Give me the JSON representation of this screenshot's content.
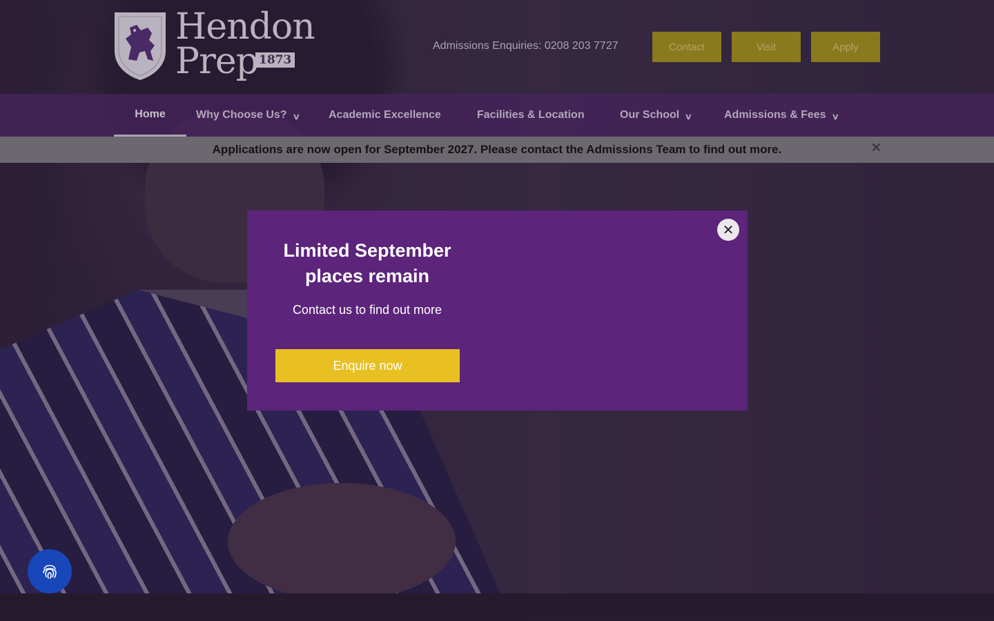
{
  "header": {
    "logo_line1": "Hendon",
    "logo_line2": "Prep",
    "logo_year": "1873",
    "phone_text": "Admissions Enquiries: 0208 203 7727",
    "buttons": [
      "Contact",
      "Visit",
      "Apply"
    ]
  },
  "nav": {
    "items": [
      {
        "label": "Home",
        "active": true
      },
      {
        "label": "Why Choose Us?",
        "dropdown": true
      },
      {
        "label": "Academic Excellence"
      },
      {
        "label": "Facilities & Location"
      },
      {
        "label": "Our School",
        "dropdown": true
      },
      {
        "label": "Admissions & Fees",
        "dropdown": true
      }
    ],
    "chevron_icon": "chevron-down-icon"
  },
  "banner": {
    "text": "Applications are now open for September 2027. Please contact the Admissions Team to find out more.",
    "close_icon": "close-icon"
  },
  "modal": {
    "title_line1": "Limited September",
    "title_line2": "places remain",
    "subtitle": "Contact us to find out more",
    "cta": "Enquire now",
    "close_icon": "close-icon"
  },
  "accessibility": {
    "icon": "fingerprint-icon"
  },
  "colors": {
    "brand_purple": "#5c247b",
    "cta_yellow": "#e8c021",
    "fab_blue": "#1747b8"
  }
}
